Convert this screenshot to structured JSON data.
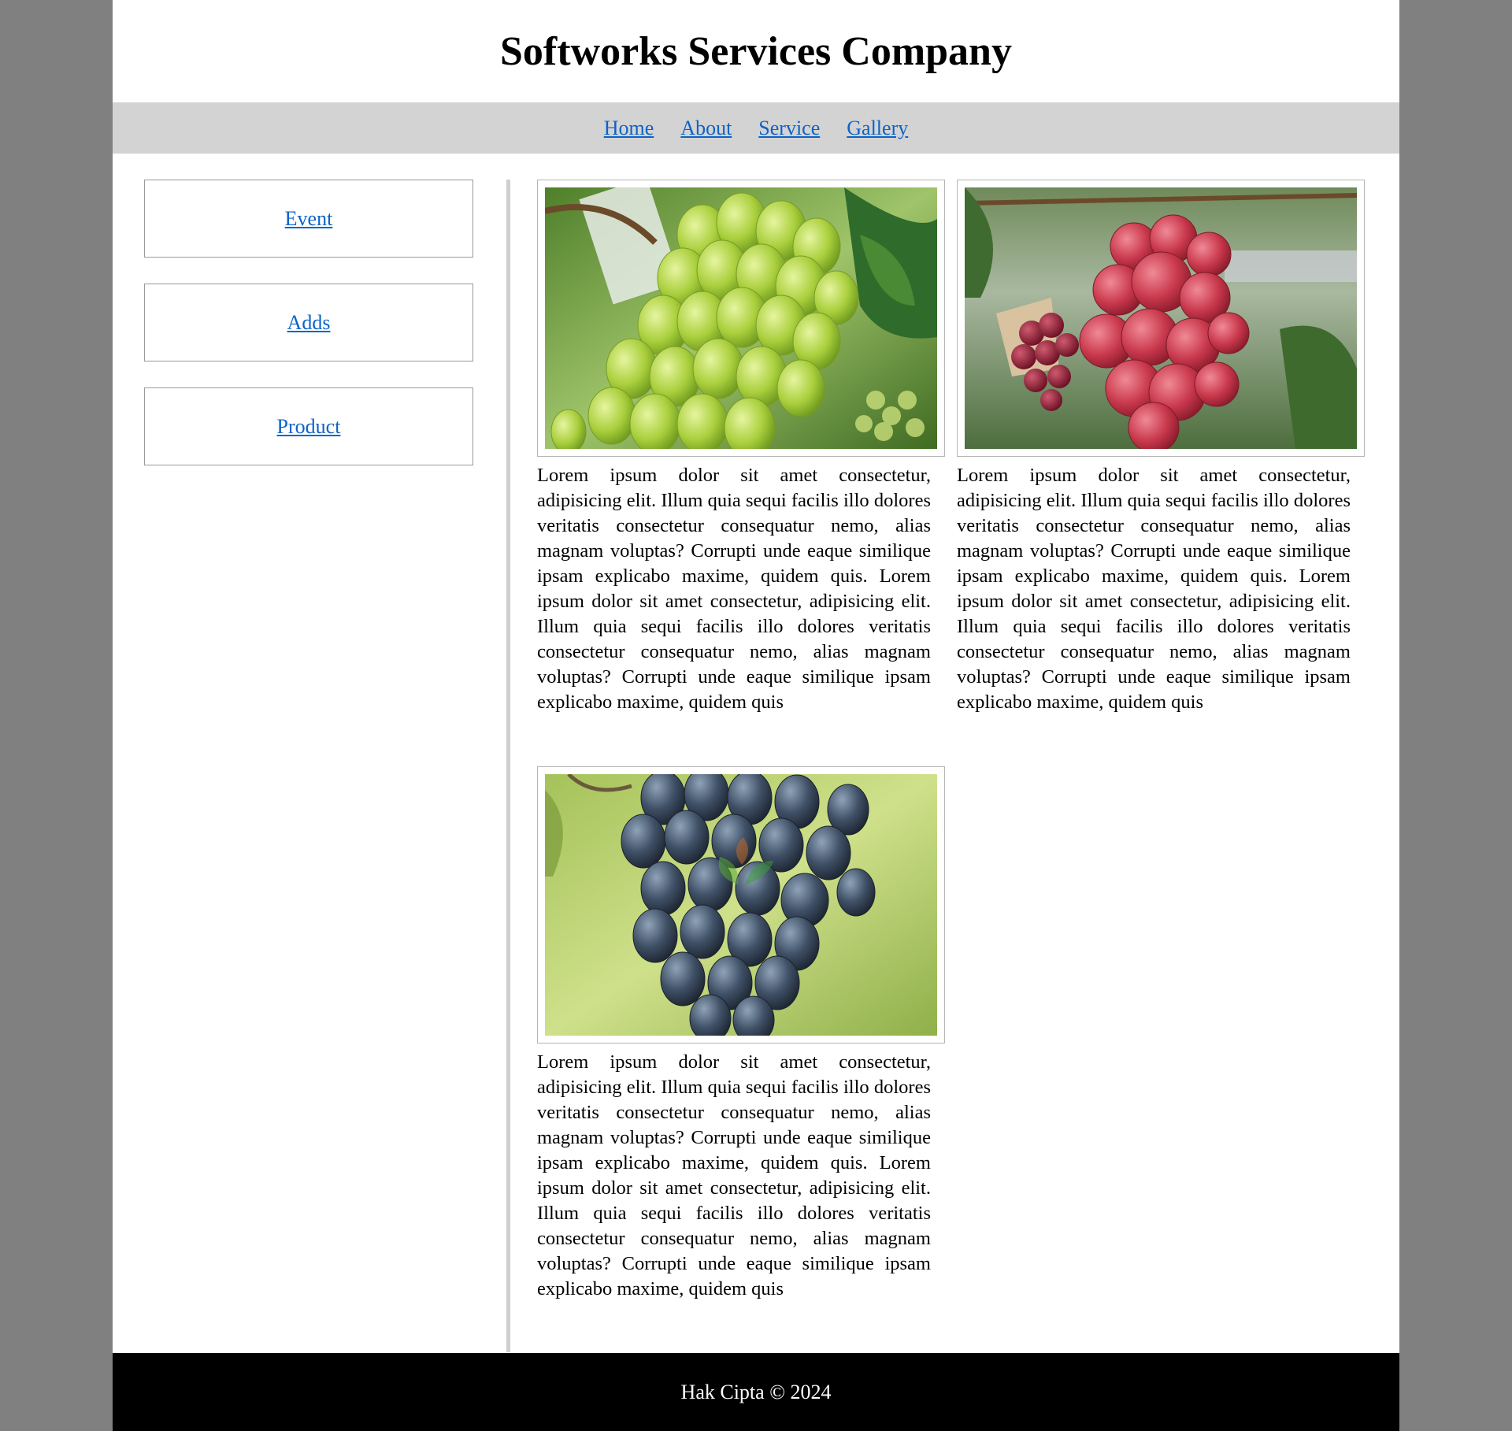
{
  "header": {
    "title": "Softworks Services Company"
  },
  "nav": {
    "items": [
      {
        "label": "Home"
      },
      {
        "label": "About"
      },
      {
        "label": "Service"
      },
      {
        "label": "Gallery"
      }
    ]
  },
  "sidebar": {
    "items": [
      {
        "label": "Event"
      },
      {
        "label": "Adds"
      },
      {
        "label": "Product"
      }
    ]
  },
  "gallery": {
    "cards": [
      {
        "image": "green-grapes-photo",
        "text": "Lorem ipsum dolor sit amet consectetur, adipisicing elit. Illum quia sequi facilis illo dolores veritatis consectetur consequatur nemo, alias magnam voluptas? Corrupti unde eaque similique ipsam explicabo maxime, quidem quis. Lorem ipsum dolor sit amet consectetur, adipisicing elit. Illum quia sequi facilis illo dolores veritatis consectetur consequatur nemo, alias magnam voluptas? Corrupti unde eaque similique ipsam explicabo maxime, quidem quis"
      },
      {
        "image": "red-grapes-photo",
        "text": "Lorem ipsum dolor sit amet consectetur, adipisicing elit. Illum quia sequi facilis illo dolores veritatis consectetur consequatur nemo, alias magnam voluptas? Corrupti unde eaque similique ipsam explicabo maxime, quidem quis. Lorem ipsum dolor sit amet consectetur, adipisicing elit. Illum quia sequi facilis illo dolores veritatis consectetur consequatur nemo, alias magnam voluptas? Corrupti unde eaque similique ipsam explicabo maxime, quidem quis"
      },
      {
        "image": "black-grapes-photo",
        "text": "Lorem ipsum dolor sit amet consectetur, adipisicing elit. Illum quia sequi facilis illo dolores veritatis consectetur consequatur nemo, alias magnam voluptas? Corrupti unde eaque similique ipsam explicabo maxime, quidem quis. Lorem ipsum dolor sit amet consectetur, adipisicing elit. Illum quia sequi facilis illo dolores veritatis consectetur consequatur nemo, alias magnam voluptas? Corrupti unde eaque similique ipsam explicabo maxime, quidem quis"
      }
    ]
  },
  "footer": {
    "copyright": "Hak Cipta © 2024"
  },
  "colors": {
    "outer_background": "#808080",
    "navbar_background": "#d3d3d3",
    "link": "#0b63c9",
    "footer_background": "#000000",
    "divider": "#cfcfcf"
  }
}
